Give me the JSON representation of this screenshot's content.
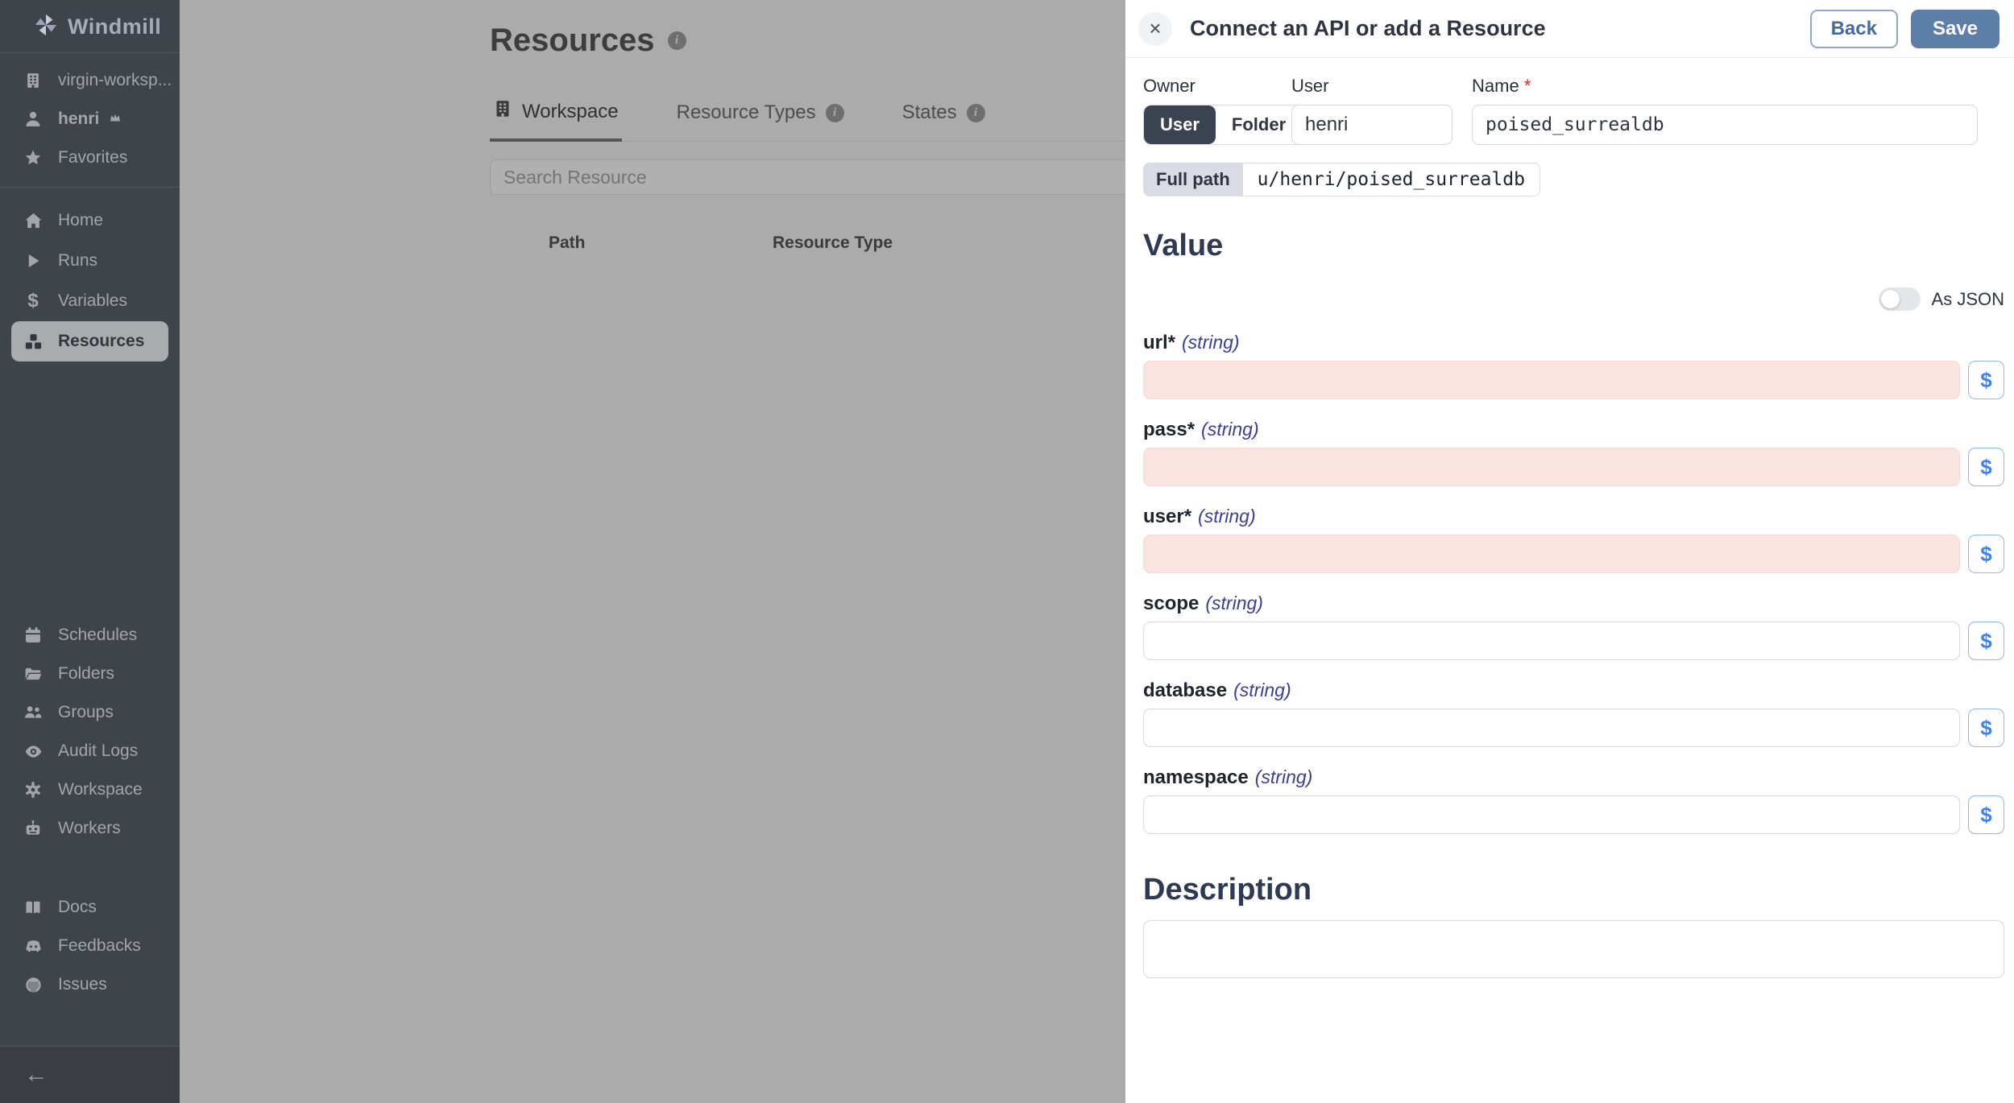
{
  "sidebar": {
    "logo": "Windmill",
    "workspace": "virgin-worksp...",
    "user": "henri",
    "favorites": "Favorites",
    "nav": [
      {
        "label": "Home",
        "icon": "home-icon",
        "active": false
      },
      {
        "label": "Runs",
        "icon": "play-icon",
        "active": false
      },
      {
        "label": "Variables",
        "icon": "dollar-icon",
        "active": false
      },
      {
        "label": "Resources",
        "icon": "boxes-icon",
        "active": true
      }
    ],
    "admin": [
      {
        "label": "Schedules",
        "icon": "calendar-icon"
      },
      {
        "label": "Folders",
        "icon": "folder-icon"
      },
      {
        "label": "Groups",
        "icon": "groups-icon"
      },
      {
        "label": "Audit Logs",
        "icon": "eye-icon"
      },
      {
        "label": "Workspace",
        "icon": "gear-icon"
      },
      {
        "label": "Workers",
        "icon": "robot-icon"
      }
    ],
    "footer": [
      {
        "label": "Docs",
        "icon": "book-icon"
      },
      {
        "label": "Feedbacks",
        "icon": "discord-icon"
      },
      {
        "label": "Issues",
        "icon": "github-icon"
      }
    ],
    "collapse_icon": "left-arrow-icon"
  },
  "main": {
    "title": "Resources",
    "tabs": [
      {
        "label": "Workspace",
        "active": true,
        "has_info": false
      },
      {
        "label": "Resource Types",
        "active": false,
        "has_info": true
      },
      {
        "label": "States",
        "active": false,
        "has_info": true
      }
    ],
    "search_placeholder": "Search Resource",
    "table_headers": [
      "Path",
      "Resource Type"
    ]
  },
  "drawer": {
    "title": "Connect an API or add a Resource",
    "back_label": "Back",
    "save_label": "Save",
    "owner": {
      "owner_label": "Owner",
      "user_col_label": "User",
      "name_label": "Name",
      "toggle_user": "User",
      "toggle_folder": "Folder",
      "toggle_selected": "User",
      "user_value": "henri",
      "name_value": "poised_surrealdb",
      "full_path_label": "Full path",
      "full_path_value": "u/henri/poised_surrealdb"
    },
    "value_section": {
      "heading": "Value",
      "as_json_label": "As JSON",
      "as_json_on": false,
      "fields": [
        {
          "name": "url",
          "type": "(string)",
          "required": true,
          "invalid": true,
          "value": ""
        },
        {
          "name": "pass",
          "type": "(string)",
          "required": true,
          "invalid": true,
          "value": ""
        },
        {
          "name": "user",
          "type": "(string)",
          "required": true,
          "invalid": true,
          "value": ""
        },
        {
          "name": "scope",
          "type": "(string)",
          "required": false,
          "invalid": false,
          "value": ""
        },
        {
          "name": "database",
          "type": "(string)",
          "required": false,
          "invalid": false,
          "value": ""
        },
        {
          "name": "namespace",
          "type": "(string)",
          "required": false,
          "invalid": false,
          "value": ""
        }
      ],
      "variable_button_label": "$"
    },
    "description_heading": "Description",
    "description_value": ""
  },
  "colors": {
    "save_button": "#5d7ea7",
    "required_star": "#dc2626",
    "invalid_field_bg": "#fbe3e1",
    "variable_button_blue": "#3c82f6",
    "sidebar_bg": "#3f434a",
    "overlay_gray": "#ababab",
    "selected_segment": "#3b4250"
  }
}
